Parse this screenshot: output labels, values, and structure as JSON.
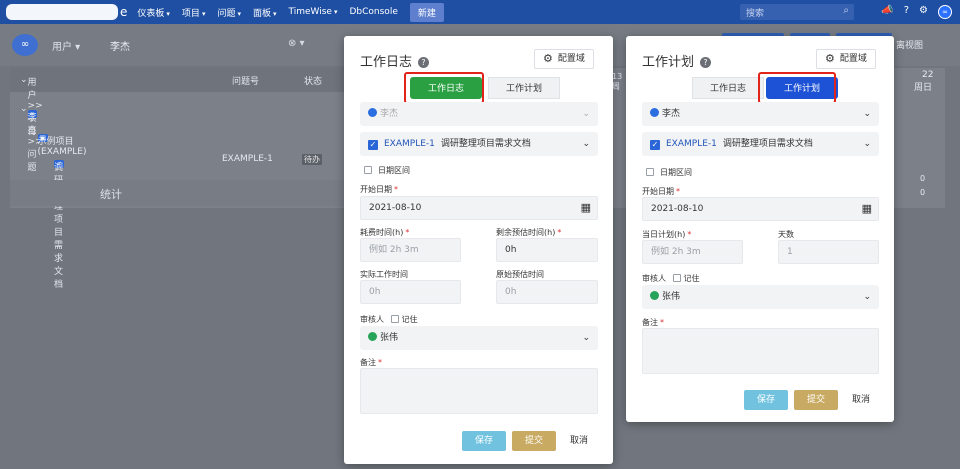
{
  "nav": {
    "brand_tail": "e",
    "items": [
      {
        "label": "仪表板"
      },
      {
        "label": "项目"
      },
      {
        "label": "问题"
      },
      {
        "label": "面板"
      },
      {
        "label": "TimeWise"
      },
      {
        "label": "DbConsole"
      }
    ],
    "new_label": "新建",
    "search_placeholder": "搜索"
  },
  "filter": {
    "user_label": "用户",
    "user_value": "李杰",
    "right_text": "离视图"
  },
  "grid": {
    "headers": {
      "tree": "用户 >> 项目 >> 问题",
      "issue_no": "问题号",
      "status": "状态"
    },
    "user_row": "李杰",
    "project_row": "示例项目(EXAMPLE)",
    "issue_row": {
      "title": "调研整理项目需求文档",
      "key": "EXAMPLE-1",
      "status": "待办"
    },
    "stats_label": "统计",
    "right": {
      "number": "22",
      "day": "周日",
      "zeros": [
        "0",
        "0"
      ]
    },
    "mid_number": "13",
    "mid_day": "周"
  },
  "log_dialog": {
    "title": "工作日志",
    "config_label": "配置域",
    "tab_log": "工作日志",
    "tab_plan": "工作计划",
    "user": "李杰",
    "issue_key": "EXAMPLE-1",
    "issue_title": "调研整理项目需求文档",
    "date_range_label": "日期区间",
    "start_date_label": "开始日期",
    "start_date": "2021-08-10",
    "time_spent_label": "耗费时间(h)",
    "time_spent_placeholder": "例如 2h 3m",
    "remaining_label": "剩余预估时间(h)",
    "remaining_value": "0h",
    "actual_label": "实际工作时间",
    "actual_value": "0h",
    "original_label": "原始预估时间",
    "original_value": "0h",
    "reviewer_label": "审核人",
    "remember_label": "记住",
    "reviewer": "张伟",
    "note_label": "备注",
    "save": "保存",
    "submit": "提交",
    "cancel": "取消"
  },
  "plan_dialog": {
    "title": "工作计划",
    "config_label": "配置域",
    "tab_log": "工作日志",
    "tab_plan": "工作计划",
    "user": "李杰",
    "issue_key": "EXAMPLE-1",
    "issue_title": "调研整理项目需求文档",
    "date_range_label": "日期区间",
    "start_date_label": "开始日期",
    "start_date": "2021-08-10",
    "daily_plan_label": "当日计划(h)",
    "daily_plan_placeholder": "例如 2h 3m",
    "days_label": "天数",
    "days_value": "1",
    "reviewer_label": "审核人",
    "remember_label": "记住",
    "reviewer": "张伟",
    "note_label": "备注",
    "save": "保存",
    "submit": "提交",
    "cancel": "取消"
  },
  "colors": {
    "nav": "#1f4fa3",
    "green_tab": "#2aa043",
    "blue_tab": "#1d52d6",
    "highlight": "#e2231a",
    "save": "#70c2df",
    "submit": "#c9aa62"
  }
}
